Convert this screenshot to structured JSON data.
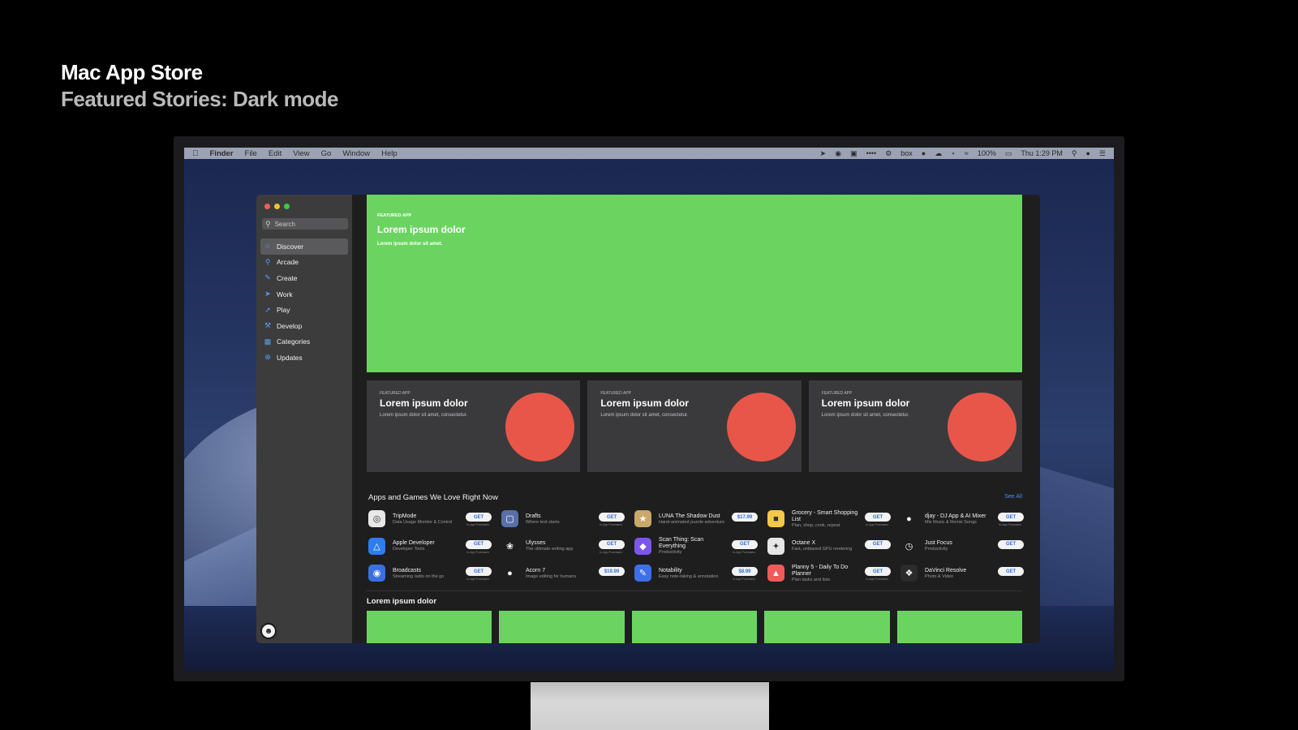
{
  "slide": {
    "title": "Mac App Store",
    "subtitle": "Featured Stories: Dark mode"
  },
  "menubar": {
    "apple_icon": "apple-icon",
    "app": "Finder",
    "menus": [
      "File",
      "Edit",
      "View",
      "Go",
      "Window",
      "Help"
    ],
    "status": {
      "box": "box",
      "battery": "100%",
      "clock": "Thu 1:29 PM"
    }
  },
  "sidebar": {
    "search_placeholder": "Search",
    "items": [
      {
        "label": "Discover",
        "icon": "star-icon",
        "active": true
      },
      {
        "label": "Arcade",
        "icon": "joystick-icon"
      },
      {
        "label": "Create",
        "icon": "brush-icon"
      },
      {
        "label": "Work",
        "icon": "paper-plane-icon"
      },
      {
        "label": "Play",
        "icon": "rocket-icon"
      },
      {
        "label": "Develop",
        "icon": "hammer-icon"
      },
      {
        "label": "Categories",
        "icon": "grid-icon"
      },
      {
        "label": "Updates",
        "icon": "download-icon"
      }
    ]
  },
  "hero": {
    "eyebrow": "FEATURED APP",
    "title": "Lorem ipsum dolor",
    "text": "Lorem ipsum dolor sit amet."
  },
  "cards": [
    {
      "eyebrow": "FEATURED APP",
      "title": "Lorem ipsum dolor",
      "text": "Lorem ipsum dolor sit amet, consectetur."
    },
    {
      "eyebrow": "FEATURED APP",
      "title": "Lorem ipsum dolor",
      "text": "Lorem ipsum dolor sit amet, consectetur."
    },
    {
      "eyebrow": "FEATURED APP",
      "title": "Lorem ipsum dolor",
      "text": "Lorem ipsum dolor sit amet, consectetur."
    }
  ],
  "apps_section": {
    "title": "Apps and Games We Love Right Now",
    "see_all": "See All"
  },
  "apps": [
    [
      {
        "name": "TripMode",
        "sub": "Data Usage Monitor & Control",
        "button": "GET",
        "iap": "In-App Purchases",
        "color": "#e8e8e8",
        "icon": "tripmode-icon"
      },
      {
        "name": "Apple Developer",
        "sub": "Developer Tools",
        "button": "GET",
        "iap": "In-App Purchases",
        "color": "#2d7cf0",
        "icon": "apple-developer-icon"
      },
      {
        "name": "Broadcasts",
        "sub": "Streaming radio on the go",
        "button": "GET",
        "iap": "In-App Purchases",
        "color": "#3b6fe0",
        "icon": "broadcasts-icon"
      }
    ],
    [
      {
        "name": "Drafts",
        "sub": "Where text starts",
        "button": "GET",
        "iap": "In-App Purchases",
        "color": "#5a6fa8",
        "icon": "drafts-icon"
      },
      {
        "name": "Ulysses",
        "sub": "The ultimate writing app",
        "button": "GET",
        "iap": "In-App Purchases",
        "color": "#1e1e1e",
        "icon": "ulysses-icon"
      },
      {
        "name": "Acorn 7",
        "sub": "Image editing for humans",
        "button": "$19.99",
        "iap": "",
        "color": "#1e1e1e",
        "icon": "acorn-icon"
      }
    ],
    [
      {
        "name": "LUNA The Shadow Dust",
        "sub": "Hand-animated puzzle adventure",
        "button": "$17.99",
        "iap": "",
        "color": "#c9a86a",
        "icon": "luna-icon"
      },
      {
        "name": "Scan Thing: Scan Everything",
        "sub": "Productivity",
        "button": "GET",
        "iap": "In-App Purchases",
        "color": "#7b57e8",
        "icon": "scan-thing-icon"
      },
      {
        "name": "Notability",
        "sub": "Easy note-taking & annotation",
        "button": "$8.99",
        "iap": "In-App Purchases",
        "color": "#3d6fe8",
        "icon": "notability-icon"
      }
    ],
    [
      {
        "name": "Grocery - Smart Shopping List",
        "sub": "Plan, shop, cook, repeat",
        "button": "GET",
        "iap": "In-App Purchases",
        "color": "#f5c84a",
        "icon": "grocery-icon"
      },
      {
        "name": "Octane X",
        "sub": "Fast, unbiased GPU rendering",
        "button": "GET",
        "iap": "",
        "color": "#e6e6e6",
        "icon": "octane-icon"
      },
      {
        "name": "Planny 5 - Daily To Do Planner",
        "sub": "Plan tasks and lists",
        "button": "GET",
        "iap": "In-App Purchases",
        "color": "#f05a5a",
        "icon": "planny-icon"
      }
    ],
    [
      {
        "name": "djay - DJ App & AI Mixer",
        "sub": "Mix Music & Remix Songs",
        "button": "GET",
        "iap": "In-App Purchases",
        "color": "#1e1e1e",
        "icon": "djay-icon"
      },
      {
        "name": "Just Focus",
        "sub": "Productivity",
        "button": "GET",
        "iap": "",
        "color": "#1e1e1e",
        "icon": "just-focus-icon"
      },
      {
        "name": "DaVinci Resolve",
        "sub": "Photo & Video",
        "button": "GET",
        "iap": "",
        "color": "#2b2b2b",
        "icon": "davinci-resolve-icon"
      }
    ]
  ],
  "section2": {
    "title": "Lorem ipsum dolor"
  },
  "colors": {
    "accent": "#6bd461",
    "circle": "#e8564a",
    "link": "#4a8af4"
  }
}
